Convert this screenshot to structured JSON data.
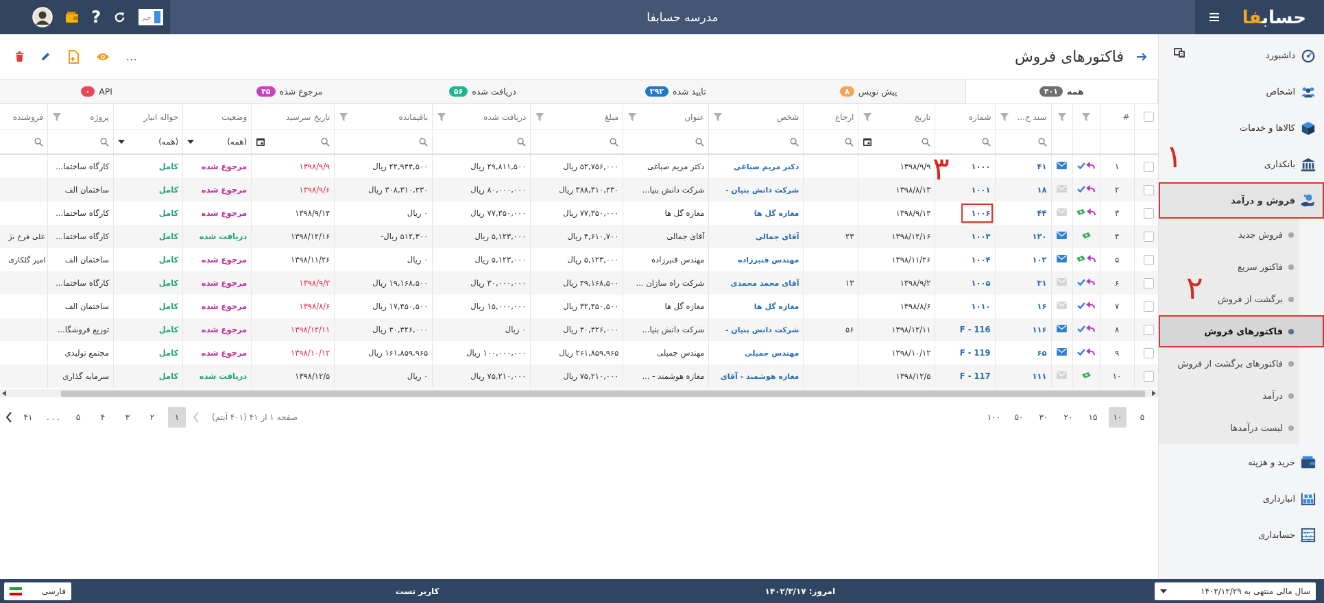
{
  "header": {
    "logo": {
      "text": "حساب",
      "accent": "فا"
    },
    "title": "مدرسه حسابفا",
    "news": {
      "label": "خبر"
    },
    "help": "?"
  },
  "page": {
    "title": "فاکتورهای فروش",
    "more": "..."
  },
  "tabs": [
    {
      "label": "همه",
      "count": "۴۰۱",
      "color": "#6f6f6f",
      "selected": true
    },
    {
      "label": "پیش نویس",
      "count": "۸",
      "color": "#f2a55a",
      "selected": false
    },
    {
      "label": "تایید شده",
      "count": "۲۹۲",
      "color": "#1f78c8",
      "selected": false
    },
    {
      "label": "دریافت شده",
      "count": "۵۶",
      "color": "#20b58f",
      "selected": false
    },
    {
      "label": "مرجوع شده",
      "count": "۴۵",
      "color": "#cc3fc0",
      "selected": false
    },
    {
      "label": "API",
      "count": "۰",
      "color": "#e8485a",
      "selected": false
    }
  ],
  "table": {
    "select_all": {
      "checked": false
    },
    "columns": [
      {
        "label": "#",
        "filter": false
      },
      {
        "filter": true
      },
      {
        "filter": true
      },
      {
        "label": "سند ح...",
        "filter": true,
        "search": true
      },
      {
        "label": "شماره",
        "filter": false,
        "search": true
      },
      {
        "label": "تاریخ",
        "filter": true,
        "search": true,
        "calendar": true
      },
      {
        "label": "ارجاع",
        "filter": false,
        "search": true
      },
      {
        "label": "شخص",
        "filter": true,
        "search": true
      },
      {
        "label": "عنوان",
        "filter": true,
        "search": true
      },
      {
        "label": "مبلغ",
        "filter": true,
        "search": true
      },
      {
        "label": "دریافت شده",
        "filter": true,
        "search": true
      },
      {
        "label": "باقیمانده",
        "filter": true,
        "search": true
      },
      {
        "label": "تاریخ سرسید",
        "filter": false,
        "search": true,
        "calendar": true
      },
      {
        "label": "وضعیت",
        "filter": false,
        "dropdown": "(همه)"
      },
      {
        "label": "حواله انبار",
        "filter": false,
        "dropdown": "(همه)"
      },
      {
        "label": "پروژه",
        "filter": true,
        "search": true
      },
      {
        "label": "فروشنده",
        "filter": false,
        "search": true
      }
    ],
    "rows": [
      {
        "checked": false,
        "index": "۱",
        "returned": true,
        "confirmed": true,
        "paid": false,
        "emailed": true,
        "doc_no": "۴۱",
        "number": "۱۰۰۰",
        "marked": false,
        "date": "۱۳۹۸/۹/۹",
        "person": "دکتر مریم صباغی",
        "title": "دکتر مریم صباغی",
        "amount": "۵۲,۷۵۶,۰۰۰ ریال",
        "received": "۲۹,۸۱۱,۵۰۰ ریال",
        "remaining": "۲۲,۹۴۴,۵۰۰ ریال",
        "due_date": "۱۳۹۸/۹/۹",
        "overdue": true,
        "status": {
          "label": "مرجوع شده",
          "kind": "returned"
        },
        "warehouse": "کامل",
        "project": "کارگاه ساختما..."
      },
      {
        "checked": false,
        "index": "۲",
        "returned": true,
        "confirmed": true,
        "paid": false,
        "emailed": false,
        "doc_no": "۱۸",
        "number": "۱۰۰۱",
        "marked": false,
        "date": "۱۳۹۸/۸/۱۳",
        "person": "شرکت دانش بنیان -",
        "title": "شرکت دانش بنیا...",
        "amount": "۳۸۸,۳۱۰,۴۳۰ ریال",
        "received": "۸۰,۰۰۰,۰۰۰ ریال",
        "remaining": "۳۰۸,۳۱۰,۴۳۰ ریال",
        "due_date": "۱۳۹۸/۹/۶",
        "overdue": true,
        "status": {
          "label": "مرجوع شده",
          "kind": "returned"
        },
        "warehouse": "کامل",
        "project": "ساختمان الف"
      },
      {
        "checked": false,
        "index": "۳",
        "returned": true,
        "confirmed": false,
        "paid": true,
        "emailed": false,
        "doc_no": "۴۴",
        "number": "۱۰۰۶",
        "marked": true,
        "annotation": "۳",
        "date": "۱۳۹۸/۹/۱۴",
        "person": "مغازه گل ها",
        "title": "مغازه گل ها",
        "amount": "۷۷,۳۵۰,۰۰۰ ریال",
        "received": "۷۷,۳۵۰,۰۰۰ ریال",
        "remaining": "۰ ریال",
        "due_date": "۱۳۹۸/۹/۱۴",
        "overdue": false,
        "status": {
          "label": "مرجوع شده",
          "kind": "returned"
        },
        "warehouse": "کامل",
        "project": "کارگاه ساختما..."
      },
      {
        "checked": false,
        "index": "۴",
        "returned": false,
        "confirmed": false,
        "paid": true,
        "emailed": true,
        "doc_no": "۱۲۰",
        "number": "۱۰۰۳",
        "marked": false,
        "date": "۱۳۹۸/۱۲/۱۶",
        "reference": "۲۳",
        "person": "آقای جمالی",
        "title": "آقای جمالی",
        "amount": "۴,۶۱۰,۷۰۰ ریال",
        "received": "۵,۱۲۳,۰۰۰ ریال",
        "remaining": "۵۱۲,۳۰۰ ریال-",
        "due_date": "۱۳۹۸/۱۲/۱۶",
        "overdue": false,
        "status": {
          "label": "دریافت شده",
          "kind": "received"
        },
        "warehouse": "کامل",
        "project": "کارگاه ساختما...",
        "vendor": "علی فرخ نژ"
      },
      {
        "checked": false,
        "index": "۵",
        "returned": true,
        "confirmed": false,
        "paid": true,
        "emailed": true,
        "doc_no": "۱۰۲",
        "number": "۱۰۰۴",
        "marked": false,
        "date": "۱۳۹۸/۱۱/۲۶",
        "person": "مهندس قنبرزاده",
        "title": "مهندس قنبرزاده",
        "amount": "۵,۱۲۳,۰۰۰ ریال",
        "received": "۵,۱۲۳,۰۰۰ ریال",
        "remaining": "۰ ریال",
        "due_date": "۱۳۹۸/۱۱/۲۶",
        "overdue": false,
        "status": {
          "label": "مرجوع شده",
          "kind": "returned"
        },
        "warehouse": "کامل",
        "project": "ساختمان الف",
        "vendor": "امیر گلکاری"
      },
      {
        "checked": false,
        "index": "۶",
        "returned": true,
        "confirmed": true,
        "paid": false,
        "emailed": false,
        "doc_no": "۳۱",
        "number": "۱۰۰۵",
        "marked": false,
        "date": "۱۳۹۸/۹/۲",
        "reference": "۱۳",
        "person": "آقای محمد محمدی",
        "title": "شرکت راه سازان ...",
        "amount": "۴۹,۱۶۸,۵۰۰ ریال",
        "received": "۳۰,۰۰۰,۰۰۰ ریال",
        "remaining": "۱۹,۱۶۸,۵۰۰ ریال",
        "due_date": "۱۳۹۸/۹/۲",
        "overdue": true,
        "status": {
          "label": "مرجوع شده",
          "kind": "returned"
        },
        "warehouse": "کامل",
        "project": "کارگاه ساختما..."
      },
      {
        "checked": false,
        "index": "۷",
        "returned": true,
        "confirmed": true,
        "paid": false,
        "emailed": false,
        "doc_no": "۱۶",
        "number": "۱۰۱۰",
        "marked": false,
        "date": "۱۳۹۸/۸/۶",
        "person": "مغازه گل ها",
        "title": "مغازه گل ها",
        "amount": "۳۲,۴۵۰,۵۰۰ ریال",
        "received": "۱۵,۰۰۰,۰۰۰ ریال",
        "remaining": "۱۷,۴۵۰,۵۰۰ ریال",
        "due_date": "۱۳۹۸/۸/۶",
        "overdue": true,
        "status": {
          "label": "مرجوع شده",
          "kind": "returned"
        },
        "warehouse": "کامل",
        "project": "ساختمان الف"
      },
      {
        "checked": false,
        "index": "۸",
        "returned": true,
        "confirmed": true,
        "paid": false,
        "emailed": true,
        "doc_no": "۱۱۶",
        "number": "F - 116",
        "marked": false,
        "date": "۱۳۹۸/۱۲/۱۱",
        "reference": "۵۶",
        "person": "شرکت دانش بنیان -",
        "title": "شرکت دانش بنیا...",
        "amount": "۴۰,۴۲۶,۰۰۰ ریال",
        "received": "۰ ریال",
        "remaining": "۴۰,۴۲۶,۰۰۰ ریال",
        "due_date": "۱۳۹۸/۱۲/۱۱",
        "overdue": true,
        "status": {
          "label": "مرجوع شده",
          "kind": "returned"
        },
        "warehouse": "کامل",
        "project": "توزیع فروشگا..."
      },
      {
        "checked": false,
        "index": "۹",
        "returned": true,
        "confirmed": true,
        "paid": false,
        "emailed": true,
        "doc_no": "۶۵",
        "number": "F - 119",
        "marked": false,
        "date": "۱۳۹۸/۱۰/۱۲",
        "person": "مهندس جمیلی",
        "title": "مهندس جمیلی",
        "amount": "۲۶۱,۸۵۹,۹۶۵ ریال",
        "received": "۱۰۰,۰۰۰,۰۰۰ ریال",
        "remaining": "۱۶۱,۸۵۹,۹۶۵ ریال",
        "due_date": "۱۳۹۸/۱۰/۱۲",
        "overdue": true,
        "status": {
          "label": "مرجوع شده",
          "kind": "returned"
        },
        "warehouse": "کامل",
        "project": "مجتمع تولیدی"
      },
      {
        "checked": false,
        "index": "۱۰",
        "returned": false,
        "confirmed": false,
        "paid": true,
        "emailed": false,
        "doc_no": "۱۱۱",
        "number": "F - 117",
        "marked": false,
        "date": "۱۳۹۸/۱۲/۵",
        "person": "مغازه هوشمند - آقای",
        "title": "مغازه هوشمند - ...",
        "amount": "۷۵,۲۱۰,۰۰۰ ریال",
        "received": "۷۵,۲۱۰,۰۰۰ ریال",
        "remaining": "۰ ریال",
        "due_date": "۱۳۹۸/۱۲/۵",
        "overdue": false,
        "status": {
          "label": "دریافت شده",
          "kind": "received"
        },
        "warehouse": "کامل",
        "project": "سرمایه گذاری"
      }
    ]
  },
  "pagination": {
    "page_sizes": [
      {
        "label": "۵",
        "selected": false
      },
      {
        "label": "۱۰",
        "selected": true
      },
      {
        "label": "۱۵",
        "selected": false
      },
      {
        "label": "۲۰",
        "selected": false
      },
      {
        "label": "۳۰",
        "selected": false
      },
      {
        "label": "۵۰",
        "selected": false
      },
      {
        "label": "۱۰۰",
        "selected": false
      }
    ],
    "info": "صفحه ۱ از ۴۱ (۴۰۱ آیتم)",
    "prev": {
      "disabled": true
    },
    "next": {
      "disabled": false
    },
    "pages": [
      {
        "label": "۱",
        "selected": true
      },
      {
        "label": "۲",
        "selected": false
      },
      {
        "label": "۳",
        "selected": false
      },
      {
        "label": "۴",
        "selected": false
      },
      {
        "label": "۵",
        "selected": false
      },
      {
        "label": ". . .",
        "selected": false
      },
      {
        "label": "۴۱",
        "selected": false
      }
    ]
  },
  "sidebar": {
    "items": [
      {
        "label": "داشبورد",
        "selected": false,
        "highlighted": false
      },
      {
        "label": "اشخاص",
        "selected": false,
        "highlighted": false
      },
      {
        "label": "کالاها و خدمات",
        "selected": false,
        "highlighted": false
      },
      {
        "label": "بانکداری",
        "selected": false,
        "highlighted": false
      },
      {
        "label": "فروش و درآمد",
        "selected": true,
        "highlighted": true,
        "annotation": "۱",
        "expanded": true,
        "children": [
          {
            "label": "فروش جدید",
            "selected": false,
            "highlighted": false
          },
          {
            "label": "فاکتور سریع",
            "selected": false,
            "highlighted": false
          },
          {
            "label": "برگشت از فروش",
            "selected": false,
            "highlighted": false
          },
          {
            "label": "فاکتورهای فروش",
            "selected": true,
            "highlighted": true,
            "annotation": "۲"
          },
          {
            "label": "فاکتورهای برگشت از فروش",
            "selected": false,
            "highlighted": false
          },
          {
            "label": "درآمد",
            "selected": false,
            "highlighted": false
          },
          {
            "label": "لیست درآمدها",
            "selected": false,
            "highlighted": false
          }
        ]
      },
      {
        "label": "خرید و هزینه",
        "selected": false,
        "highlighted": false
      },
      {
        "label": "انبارداری",
        "selected": false,
        "highlighted": false
      },
      {
        "label": "حسابداری",
        "selected": false,
        "highlighted": false
      }
    ]
  },
  "status_bar": {
    "fiscal_year": "سال مالی منتهی به ۱۴۰۲/۱۲/۲۹",
    "today": "امروز: ۱۴۰۲/۳/۱۷",
    "user": "کاربر تست",
    "language": "فارسی"
  }
}
